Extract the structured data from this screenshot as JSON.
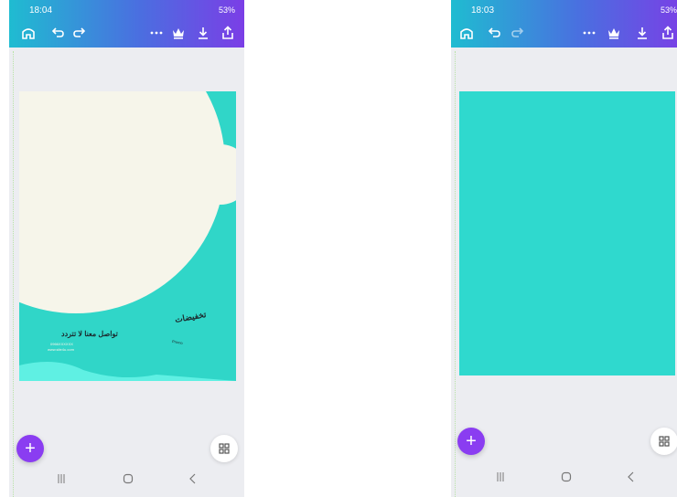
{
  "screens": [
    {
      "status_time": "18:04",
      "status_right": "53%",
      "design": {
        "headline": "تواصل معنا لا تتردد",
        "tag": "تخفيضات",
        "phone_line": "0966XXXXXX",
        "web_line": "www.site4u.com",
        "promo_small": "Promo"
      }
    },
    {
      "status_time": "18:03",
      "status_right": "53%"
    }
  ],
  "icons": {
    "home": "home-icon",
    "undo": "undo-icon",
    "redo": "redo-icon",
    "more": "more-icon",
    "crown": "crown-icon",
    "download": "download-icon",
    "share": "share-icon",
    "add": "+",
    "grid": "grid-icon"
  },
  "colors": {
    "toolbar_start": "#1fbcd1",
    "toolbar_end": "#7b3ee6",
    "design_bg": "#30d6c8",
    "cream": "#f6f5ea",
    "fab": "#8a3df1"
  }
}
